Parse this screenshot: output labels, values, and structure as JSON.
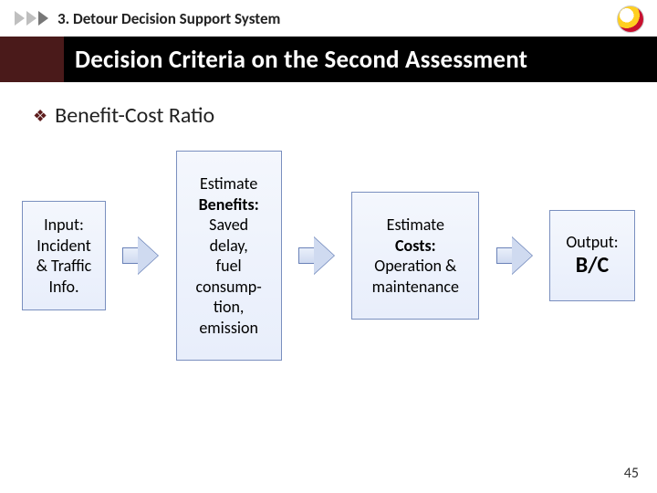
{
  "section_label": "3. Detour Decision Support System",
  "slide_title": "Decision Criteria on the Second Assessment",
  "bullet": "Benefit-Cost Ratio",
  "flow": {
    "input": {
      "line1": "Input:",
      "line2": "Incident",
      "line3": "& Traffic",
      "line4": "Info."
    },
    "benefits": {
      "line1": "Estimate",
      "line2": "Benefits:",
      "line3": "Saved",
      "line4": "delay,",
      "line5": "fuel",
      "line6": "consump-",
      "line7": "tion,",
      "line8": "emission"
    },
    "costs": {
      "line1": "Estimate",
      "line2": "Costs:",
      "line3": "Operation &",
      "line4": "maintenance"
    },
    "output": {
      "line1": "Output:",
      "line2": "B/C"
    }
  },
  "page_number": "45"
}
